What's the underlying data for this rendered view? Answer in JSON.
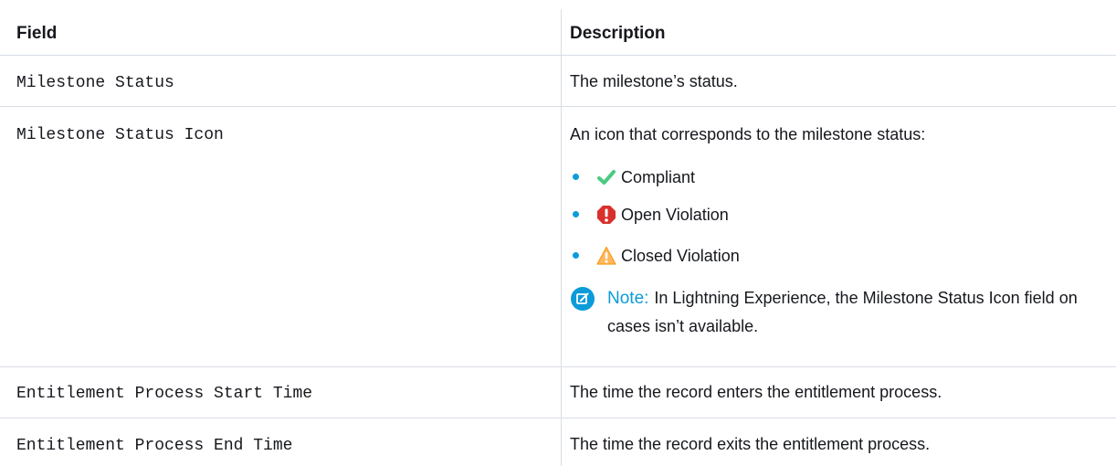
{
  "table": {
    "headers": {
      "field": "Field",
      "description": "Description"
    },
    "rows": [
      {
        "field": "Milestone Status",
        "description": "The milestone’s status."
      },
      {
        "field": "Milestone Status Icon",
        "description": "An icon that corresponds to the milestone status:",
        "bullets": [
          {
            "icon": "checkmark-icon",
            "label": "Compliant",
            "color": "#4bca81"
          },
          {
            "icon": "stop-exclamation-icon",
            "label": "Open Violation",
            "color": "#d8312c"
          },
          {
            "icon": "warning-triangle-icon",
            "label": "Closed Violation",
            "color": "#ffb75d"
          }
        ],
        "note": {
          "label": "Note:",
          "text": "In Lightning Experience, the Milestone Status Icon field on cases isn’t available."
        }
      },
      {
        "field": "Entitlement Process Start Time",
        "description": "The time the record enters the entitlement process."
      },
      {
        "field": "Entitlement Process End Time",
        "description": "The time the record exits the entitlement process."
      }
    ]
  },
  "colors": {
    "accent": "#0b9bd9",
    "divider": "#d8dde6",
    "text": "#16181d"
  }
}
